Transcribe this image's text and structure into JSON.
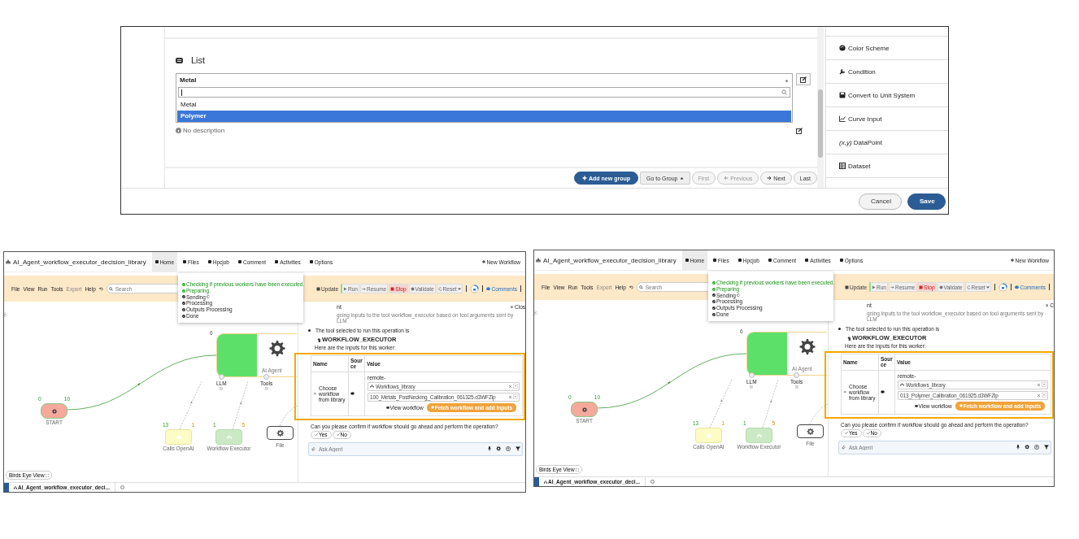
{
  "editor": {
    "section_title": "List",
    "select": {
      "value": "Metal"
    },
    "options": [
      {
        "label": "Metal",
        "selected": false
      },
      {
        "label": "Polymer",
        "selected": true
      }
    ],
    "description": "No description",
    "pager": [
      {
        "label": "Add new group",
        "kind": "primary",
        "disabled": false
      },
      {
        "label": "Go to Group",
        "kind": "dropdown",
        "disabled": false
      },
      {
        "label": "First",
        "kind": "plain",
        "disabled": true
      },
      {
        "label": "Previous",
        "kind": "back",
        "disabled": true
      },
      {
        "label": "Next",
        "kind": "forward",
        "disabled": false
      },
      {
        "label": "Last",
        "kind": "plain",
        "disabled": false
      }
    ],
    "palette": [
      {
        "label": "Color Scheme",
        "kind": "palette"
      },
      {
        "label": "Condition",
        "kind": "wrench"
      },
      {
        "label": "Convert to Unit System",
        "kind": "disk"
      },
      {
        "label": "Curve Input",
        "kind": "chart"
      },
      {
        "label": "*(x,y)* DataPoint",
        "kind": "text"
      },
      {
        "label": "Dataset",
        "kind": "table"
      }
    ],
    "actions": [
      {
        "label": "Cancel",
        "kind": "secondary"
      },
      {
        "label": "Save",
        "kind": "primary"
      }
    ]
  },
  "screens": [
    {
      "title": "AI_Agent_workflow_executor_decision_library",
      "nav": [
        {
          "label": "Home",
          "selected": true
        },
        {
          "label": "Files",
          "selected": false
        },
        {
          "label": "Hpcjob",
          "selected": false
        },
        {
          "label": "Comment",
          "selected": false
        },
        {
          "label": "Activities",
          "selected": false
        },
        {
          "label": "Options",
          "selected": false
        }
      ],
      "new_workflow": "New Workflow",
      "menu": [
        {
          "label": "File",
          "disabled": false
        },
        {
          "label": "View",
          "disabled": false
        },
        {
          "label": "Run",
          "disabled": false
        },
        {
          "label": "Tools",
          "disabled": false
        },
        {
          "label": "Export",
          "disabled": true
        },
        {
          "label": "Help",
          "disabled": false
        }
      ],
      "search": {
        "placeholder": "Search"
      },
      "toolbar": [
        {
          "label": "Update",
          "kind": "update"
        },
        {
          "label": "Run",
          "kind": "run"
        },
        {
          "label": "Resume",
          "kind": "resume"
        },
        {
          "label": "Stop",
          "kind": "stop"
        },
        {
          "label": "Validate",
          "kind": "validate"
        },
        {
          "label": "Reset",
          "kind": "reset"
        }
      ],
      "comments": "Comments",
      "progress": [
        {
          "label": "Checking if previous workers have been executed.",
          "done": true,
          "busy": false
        },
        {
          "label": "Preparing",
          "done": true,
          "busy": false
        },
        {
          "label": "Sending",
          "done": false,
          "busy": true
        },
        {
          "label": "Processing",
          "done": false,
          "busy": false
        },
        {
          "label": "Outputs Processing",
          "done": false,
          "busy": false
        },
        {
          "label": "Done",
          "done": false,
          "busy": false
        }
      ],
      "nodes": [
        {
          "label": "START",
          "kind": "start",
          "counts": [
            "0",
            "10"
          ]
        },
        {
          "label": "Calls OpenAI",
          "kind": "llm",
          "counts": [
            "13",
            "1"
          ]
        },
        {
          "label": "Workflow Executor",
          "kind": "executor",
          "counts": [
            "1",
            "5"
          ]
        },
        {
          "label": "File",
          "kind": "file"
        },
        {
          "label": "AI Agent",
          "kind": "agent",
          "counts": [
            "6"
          ],
          "ports": [
            "LLM",
            "Tools"
          ]
        }
      ],
      "chat": {
        "heading": "nt",
        "close": "× Clos",
        "note": "gning inputs to the tool workflow_executor based on tool arguments sent by LLM",
        "intro": "The tool selected to run this operation is",
        "tool": "WORKFLOW_EXECUTOR",
        "inputs_label": "Here are the inputs for this worker:",
        "columns": [
          "Name",
          "Source",
          "Value"
        ],
        "row": {
          "name": "Choose workflow from library",
          "value_label": "remote-",
          "selects": [
            "Workflows_library",
            "100_Metals_PostNecking_Calibration_061325.d3WFZip"
          ],
          "view": "View workflow",
          "fetch": "Fetch workflow and add inputs"
        },
        "question": "Can you please confirm if workflow should go ahead and perform the operation?",
        "answers": [
          "Yes",
          "No"
        ],
        "input": {
          "placeholder": "Ask Agent"
        }
      },
      "birds_eye": "Birds Eye View",
      "tab": "AI_Agent_workflow_executor_deci..."
    },
    {
      "title": "AI_Agent_workflow_executor_decision_library",
      "nav": [
        {
          "label": "Home",
          "selected": true
        },
        {
          "label": "Files",
          "selected": false
        },
        {
          "label": "Hpcjob",
          "selected": false
        },
        {
          "label": "Comment",
          "selected": false
        },
        {
          "label": "Activities",
          "selected": false
        },
        {
          "label": "Options",
          "selected": false
        }
      ],
      "new_workflow": "New Workflow",
      "menu": [
        {
          "label": "File",
          "disabled": false
        },
        {
          "label": "View",
          "disabled": false
        },
        {
          "label": "Run",
          "disabled": false
        },
        {
          "label": "Tools",
          "disabled": false
        },
        {
          "label": "Export",
          "disabled": true
        },
        {
          "label": "Help",
          "disabled": false
        }
      ],
      "search": {
        "placeholder": "Search"
      },
      "toolbar": [
        {
          "label": "Update",
          "kind": "update"
        },
        {
          "label": "Run",
          "kind": "run"
        },
        {
          "label": "Resume",
          "kind": "resume"
        },
        {
          "label": "Stop",
          "kind": "stop"
        },
        {
          "label": "Validate",
          "kind": "validate"
        },
        {
          "label": "Reset",
          "kind": "reset"
        }
      ],
      "comments": "Comments",
      "progress": [
        {
          "label": "Checking if previous workers have been executed.",
          "done": true,
          "busy": false
        },
        {
          "label": "Preparing",
          "done": true,
          "busy": false
        },
        {
          "label": "Sending",
          "done": false,
          "busy": true
        },
        {
          "label": "Processing",
          "done": false,
          "busy": false
        },
        {
          "label": "Outputs Processing",
          "done": false,
          "busy": false
        },
        {
          "label": "Done",
          "done": false,
          "busy": false
        }
      ],
      "nodes": [
        {
          "label": "START",
          "kind": "start",
          "counts": [
            "0",
            "10"
          ]
        },
        {
          "label": "Calls OpenAI",
          "kind": "llm",
          "counts": [
            "13",
            "1"
          ]
        },
        {
          "label": "Workflow Executor",
          "kind": "executor",
          "counts": [
            "1",
            "5"
          ]
        },
        {
          "label": "File",
          "kind": "file"
        },
        {
          "label": "AI Agent",
          "kind": "agent",
          "counts": [
            "6"
          ],
          "ports": [
            "LLM",
            "Tools"
          ]
        }
      ],
      "chat": {
        "heading": "nt",
        "close": "× C",
        "note": "gning inputs to the tool workflow_executor based on tool arguments sent by LLM",
        "intro": "The tool selected to run this operation is",
        "tool": "WORKFLOW_EXECUTOR",
        "inputs_label": "Here are the inputs for this worker:",
        "columns": [
          "Name",
          "Source",
          "Value"
        ],
        "row": {
          "name": "Choose workflow from library",
          "value_label": "remote-",
          "selects": [
            "Workflows_library",
            "013_Polymer_Calibration_061925.d3WFZip"
          ],
          "view": "View workflow",
          "fetch": "Fetch workflow and add inputs"
        },
        "question": "Can you please confirm if workflow should go ahead and perform the operation?",
        "answers": [
          "Yes",
          "No"
        ],
        "input": {
          "placeholder": "Ask Agent"
        }
      },
      "birds_eye": "Birds Eye View",
      "tab": "AI_Agent_workflow_executor_deci..."
    }
  ]
}
